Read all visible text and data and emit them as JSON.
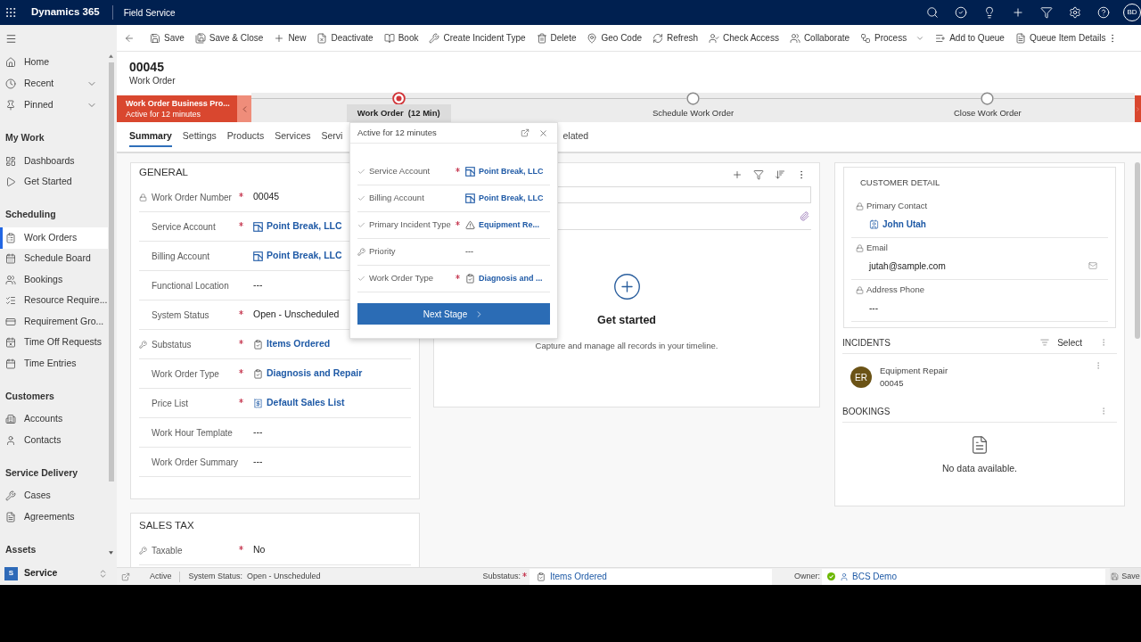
{
  "top_bar": {
    "app_name": "Dynamics 365",
    "area_name": "Field Service",
    "user_initials": "BD"
  },
  "sidebar": {
    "sections": [
      {
        "items": [
          {
            "label": "Home",
            "kind": "link",
            "selected": false
          },
          {
            "label": "Recent",
            "kind": "flyout",
            "selected": false
          },
          {
            "label": "Pinned",
            "kind": "flyout",
            "selected": false
          }
        ]
      },
      {
        "title": "My Work",
        "items": [
          {
            "label": "Dashboards",
            "selected": false
          },
          {
            "label": "Get Started",
            "selected": false
          }
        ]
      },
      {
        "title": "Scheduling",
        "items": [
          {
            "label": "Work Orders",
            "selected": true
          },
          {
            "label": "Schedule Board",
            "selected": false
          },
          {
            "label": "Bookings",
            "selected": false
          },
          {
            "label": "Resource Require...",
            "selected": false
          },
          {
            "label": "Requirement Gro...",
            "selected": false
          },
          {
            "label": "Time Off Requests",
            "selected": false
          },
          {
            "label": "Time Entries",
            "selected": false
          }
        ]
      },
      {
        "title": "Customers",
        "items": [
          {
            "label": "Accounts",
            "selected": false
          },
          {
            "label": "Contacts",
            "selected": false
          }
        ]
      },
      {
        "title": "Service Delivery",
        "items": [
          {
            "label": "Cases",
            "selected": false
          },
          {
            "label": "Agreements",
            "selected": false
          }
        ]
      },
      {
        "title": "Assets"
      }
    ],
    "area_switcher": {
      "initial": "S",
      "label": "Service"
    }
  },
  "command_bar": {
    "commands": [
      {
        "label": "Save",
        "has_menu": false
      },
      {
        "label": "Save & Close",
        "has_menu": false
      },
      {
        "label": "New",
        "has_menu": false
      },
      {
        "label": "Deactivate",
        "has_menu": false
      },
      {
        "label": "Book",
        "has_menu": false
      },
      {
        "label": "Create Incident Type",
        "has_menu": false
      },
      {
        "label": "Delete",
        "has_menu": false
      },
      {
        "label": "Geo Code",
        "has_menu": false
      },
      {
        "label": "Refresh",
        "has_menu": false
      },
      {
        "label": "Check Access",
        "has_menu": false
      },
      {
        "label": "Collaborate",
        "has_menu": false
      },
      {
        "label": "Process",
        "has_menu": true
      },
      {
        "label": "Add to Queue",
        "has_menu": false
      },
      {
        "label": "Queue Item Details",
        "has_menu": false
      }
    ]
  },
  "record": {
    "number": "00045",
    "entity": "Work Order"
  },
  "process_bar": {
    "name": "Work Order Business Pro...",
    "status": "Active for 12 minutes",
    "stages": [
      {
        "label": "Work Order",
        "duration": "(12 Min)",
        "selected": true
      },
      {
        "label": "Schedule Work Order",
        "selected": false
      },
      {
        "label": "Close Work Order",
        "selected": false
      }
    ]
  },
  "tabs": [
    {
      "label": "Summary",
      "selected": true
    },
    {
      "label": "Settings",
      "selected": false
    },
    {
      "label": "Products",
      "selected": false
    },
    {
      "label": "Services",
      "selected": false
    },
    {
      "label": "Servi",
      "selected": false
    },
    {
      "label": "elated",
      "selected": false
    }
  ],
  "stage_flyout": {
    "title": "Active for 12 minutes",
    "fields": [
      {
        "label": "Service Account",
        "completed": true,
        "secured": false,
        "required": true,
        "kind": "account",
        "value": "Point Break, LLC"
      },
      {
        "label": "Billing Account",
        "completed": true,
        "secured": false,
        "required": false,
        "kind": "account",
        "value": "Point Break, LLC"
      },
      {
        "label": "Primary Incident Type",
        "completed": true,
        "secured": false,
        "required": true,
        "kind": "incident",
        "value": "Equipment Re..."
      },
      {
        "label": "Priority",
        "completed": false,
        "secured": true,
        "required": false,
        "kind": "text",
        "value": "---"
      },
      {
        "label": "Work Order Type",
        "completed": true,
        "secured": false,
        "required": true,
        "kind": "type",
        "value": "Diagnosis and ..."
      }
    ],
    "next_button": "Next Stage"
  },
  "general_section": {
    "title": "GENERAL",
    "fields": [
      {
        "label": "Work Order Number",
        "locked": true,
        "secured": false,
        "required": true,
        "kind": "text",
        "value": "00045"
      },
      {
        "label": "Service Account",
        "locked": false,
        "secured": false,
        "required": true,
        "kind": "account",
        "value": "Point Break, LLC"
      },
      {
        "label": "Billing Account",
        "locked": false,
        "secured": false,
        "required": false,
        "kind": "account",
        "value": "Point Break, LLC"
      },
      {
        "label": "Functional Location",
        "locked": false,
        "secured": false,
        "required": false,
        "kind": "text",
        "value": "---"
      },
      {
        "label": "System Status",
        "locked": false,
        "secured": false,
        "required": true,
        "kind": "text",
        "value": "Open - Unscheduled"
      },
      {
        "label": "Substatus",
        "locked": false,
        "secured": true,
        "required": true,
        "kind": "type",
        "value": "Items Ordered"
      },
      {
        "label": "Work Order Type",
        "locked": false,
        "secured": false,
        "required": true,
        "kind": "type",
        "value": "Diagnosis and Repair"
      },
      {
        "label": "Price List",
        "locked": false,
        "secured": false,
        "required": true,
        "kind": "pricelist",
        "value": "Default Sales List"
      },
      {
        "label": "Work Hour Template",
        "locked": false,
        "secured": false,
        "required": false,
        "kind": "text",
        "value": "---"
      },
      {
        "label": "Work Order Summary",
        "locked": false,
        "secured": false,
        "required": false,
        "kind": "text",
        "value": "---"
      }
    ]
  },
  "sales_tax_section": {
    "title": "SALES TAX",
    "fields": [
      {
        "label": "Taxable",
        "secured": true,
        "required": true,
        "kind": "text",
        "value": "No"
      }
    ]
  },
  "timeline": {
    "empty_title": "Get started",
    "empty_text": "Capture and manage all records in your timeline."
  },
  "customer_detail": {
    "title": "CUSTOMER DETAIL",
    "fields": [
      {
        "label": "Primary Contact",
        "locked": true,
        "kind": "contact",
        "value": "John Utah"
      },
      {
        "label": "Email",
        "locked": true,
        "kind": "email",
        "value": "jutah@sample.com"
      },
      {
        "label": "Address Phone",
        "locked": true,
        "kind": "text",
        "value": "---"
      }
    ]
  },
  "incidents": {
    "title": "INCIDENTS",
    "action": "Select",
    "items": [
      {
        "initials": "ER",
        "color": "#6b5316",
        "title": "Equipment Repair",
        "number": "00045"
      }
    ]
  },
  "bookings": {
    "title": "BOOKINGS",
    "empty_text": "No data available."
  },
  "status_bar": {
    "record_state": "Active",
    "system_status_label": "System Status:",
    "system_status": "Open - Unscheduled",
    "substatus_label": "Substatus:",
    "substatus_required": true,
    "substatus": "Items Ordered",
    "owner_label": "Owner:",
    "owner_online": true,
    "owner": "BCS Demo",
    "save_label": "Save"
  }
}
